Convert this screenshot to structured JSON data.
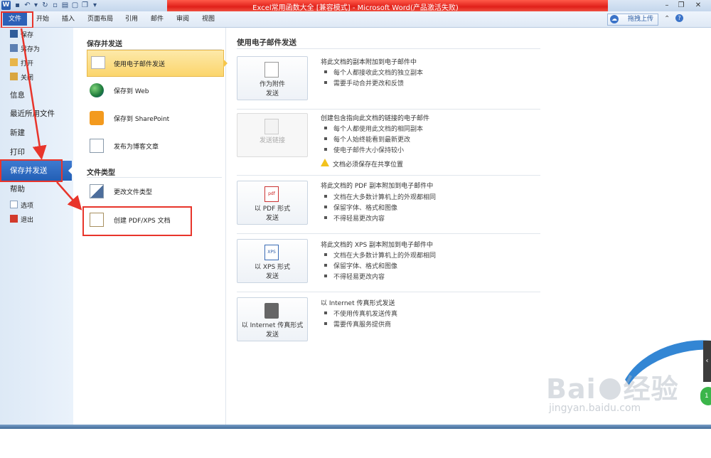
{
  "window": {
    "title": "Excel常用函数大全 [兼容模式] - Microsoft Word(产品激活失败)",
    "app_icon": "W",
    "title_bar_color": "#e52b21"
  },
  "ribbon": {
    "tabs": [
      "文件",
      "开始",
      "插入",
      "页面布局",
      "引用",
      "邮件",
      "审阅",
      "视图"
    ],
    "upload_button": "拖拽上传"
  },
  "nav": {
    "small_items": [
      {
        "label": "保存",
        "icon": "save-icon"
      },
      {
        "label": "另存为",
        "icon": "save-as-icon"
      },
      {
        "label": "打开",
        "icon": "open-folder-icon"
      },
      {
        "label": "关闭",
        "icon": "close-folder-icon"
      }
    ],
    "big_items": [
      "信息",
      "最近所用文件",
      "新建",
      "打印"
    ],
    "active": "保存并发送",
    "after_items": [
      "帮助"
    ],
    "bottom_items": [
      {
        "label": "选项",
        "icon": "options-icon"
      },
      {
        "label": "退出",
        "icon": "exit-icon"
      }
    ]
  },
  "middle": {
    "section1": "保存并发送",
    "items1": [
      {
        "label": "使用电子邮件发送",
        "icon": "email-icon"
      },
      {
        "label": "保存到 Web",
        "icon": "globe-icon"
      },
      {
        "label": "保存到 SharePoint",
        "icon": "sharepoint-icon"
      },
      {
        "label": "发布为博客文章",
        "icon": "blog-icon"
      }
    ],
    "section2": "文件类型",
    "items2": [
      {
        "label": "更改文件类型",
        "icon": "change-type-icon"
      },
      {
        "label": "创建 PDF/XPS 文档",
        "icon": "pdf-doc-icon"
      }
    ]
  },
  "right": {
    "title": "使用电子邮件发送",
    "options": [
      {
        "button": [
          "作为附件",
          "发送"
        ],
        "desc": "将此文档的副本附加到电子邮件中",
        "bullets": [
          "每个人都接收此文档的独立副本",
          "需要手动合并更改和反馈"
        ],
        "icon": "attachment-icon"
      },
      {
        "button": [
          "发送链接"
        ],
        "desc": "创建包含指向此文档的链接的电子邮件",
        "bullets": [
          "每个人都使用此文档的相同副本",
          "每个人始终能看到最新更改",
          "使电子邮件大小保持较小"
        ],
        "warning": "文档必须保存在共享位置",
        "icon": "link-icon",
        "disabled": true
      },
      {
        "button": [
          "以 PDF 形式",
          "发送"
        ],
        "desc": "将此文档的 PDF 副本附加到电子邮件中",
        "bullets": [
          "文档在大多数计算机上的外观都相同",
          "保留字体、格式和图像",
          "不得轻易更改内容"
        ],
        "icon": "pdf-icon"
      },
      {
        "button": [
          "以 XPS 形式",
          "发送"
        ],
        "desc": "将此文档的 XPS 副本附加到电子邮件中",
        "bullets": [
          "文档在大多数计算机上的外观都相同",
          "保留字体、格式和图像",
          "不得轻易更改内容"
        ],
        "icon": "xps-icon"
      },
      {
        "button": [
          "以 Internet 传真形式",
          "发送"
        ],
        "desc": "以 Internet 传真形式发送",
        "bullets": [
          "不使用传真机发送传真",
          "需要传真服务提供商"
        ],
        "icon": "fax-icon"
      }
    ]
  },
  "watermark": {
    "text": "Bai",
    "text2": "经验",
    "url": "jingyan.baidu.com"
  }
}
